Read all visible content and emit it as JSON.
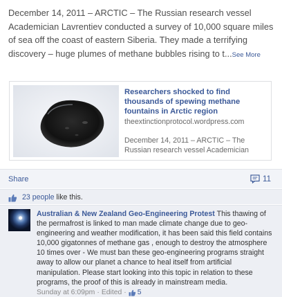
{
  "post": {
    "text": "December 14, 2011 – ARCTIC – The Russian research vessel Academician Lavrentiev conducted a survey of 10,000 square miles of sea off the coast of eastern Siberia. They made a terrifying discovery – huge plumes of methane bubbles rising to t...",
    "see_more": "See More"
  },
  "link": {
    "title": "Researchers shocked to find thousands of spewing methane fountains in Arctic region",
    "domain": "theextinctionprotocol.wordpress.com",
    "description": "December 14, 2011 – ARCTIC – The Russian research vessel Academician"
  },
  "actions": {
    "share": "Share",
    "comment_count": "11"
  },
  "likes": {
    "people": "23 people",
    "suffix": " like this."
  },
  "comment": {
    "author": "Australian & New Zealand Geo-Engineering Protest",
    "text": " This thawing of the permafrost is linked to man made climate change due to geo-engineering and weather modification, it has been said this field contains 10,000 gigatonnes of methane gas , enough to destroy the atmosphere 10 times over - We must ban these geo-engineering programs straight away to allow our planet a chance to heal itself from artificial manipulation. Please start looking into this topic in relation to these programs, the proof of this is already in mainstream media.",
    "timestamp": "Sunday at 6:09pm",
    "separator": " · ",
    "edited": "Edited",
    "like_count": "5"
  },
  "colors": {
    "link_blue": "#3b5998",
    "bar_bg": "#edeff4"
  },
  "icons": {
    "like": "thumbs-up-icon",
    "comment": "comment-bubble-icon"
  }
}
